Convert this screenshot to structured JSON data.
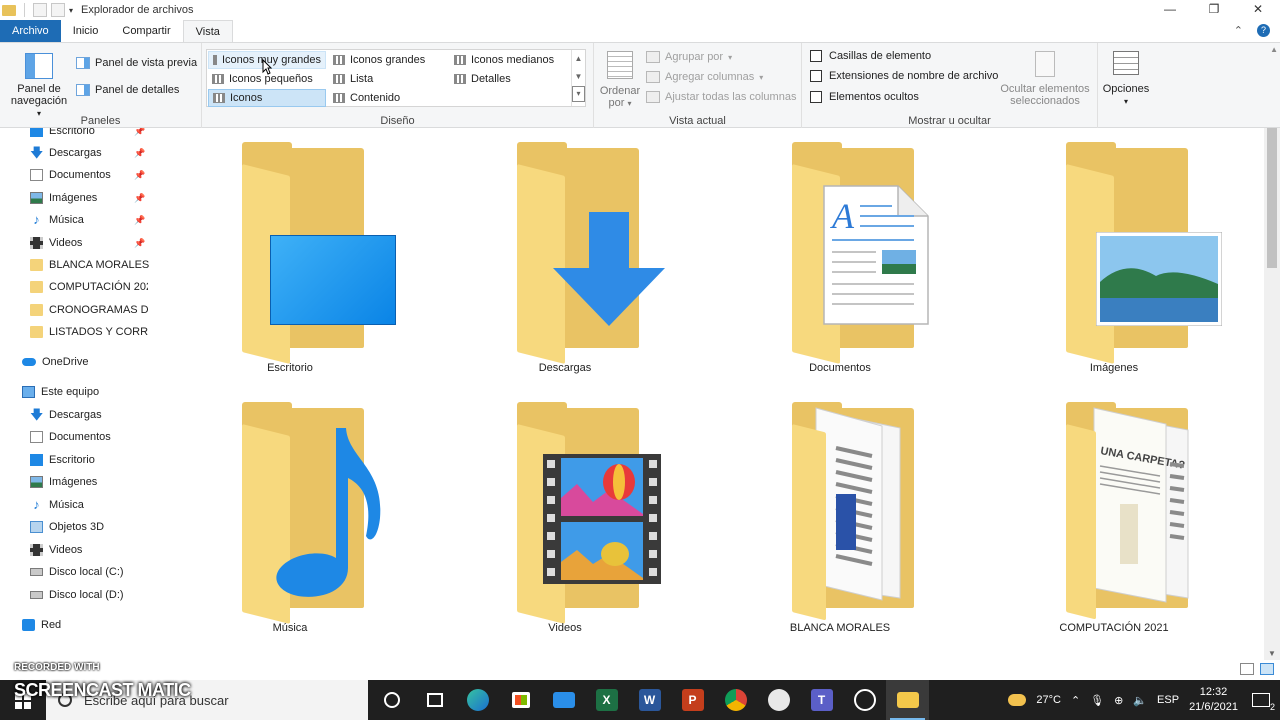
{
  "window": {
    "title": "Explorador de archivos",
    "min": "—",
    "max": "❐",
    "close": "✕"
  },
  "tabs": [
    "Archivo",
    "Inicio",
    "Compartir",
    "Vista"
  ],
  "ribbon": {
    "paneles": {
      "label": "Paneles",
      "nav_pane": "Panel de navegación",
      "preview": "Panel de vista previa",
      "details": "Panel de detalles"
    },
    "diseno": {
      "label": "Diseño",
      "layouts": [
        "Iconos muy grandes",
        "Iconos grandes",
        "Iconos medianos",
        "Iconos pequeños",
        "Lista",
        "Detalles",
        "Iconos",
        "Contenido"
      ],
      "selected": "Iconos",
      "hovered": "Iconos muy grandes"
    },
    "vista_actual": {
      "label": "Vista actual",
      "sort": "Ordenar por",
      "group": "Agrupar por",
      "add_cols": "Agregar columnas",
      "fit_cols": "Ajustar todas las columnas"
    },
    "mostrar": {
      "label": "Mostrar u ocultar",
      "checkboxes": [
        "Casillas de elemento",
        "Extensiones de nombre de archivo",
        "Elementos ocultos"
      ],
      "hide_selected": "Ocultar elementos seleccionados",
      "options": "Opciones"
    }
  },
  "nav": {
    "quick": [
      "Escritorio",
      "Descargas",
      "Documentos",
      "Imágenes",
      "Música",
      "Videos",
      "BLANCA MORALES",
      "COMPUTACIÓN 202",
      "CRONOGRAMAS DI",
      "LISTADOS Y CORREO"
    ],
    "onedrive": "OneDrive",
    "thispc": "Este equipo",
    "pc_items": [
      "Descargas",
      "Documentos",
      "Escritorio",
      "Imágenes",
      "Música",
      "Objetos 3D",
      "Videos",
      "Disco local (C:)",
      "Disco local (D:)"
    ],
    "network": "Red"
  },
  "items": [
    {
      "name": "Escritorio",
      "kind": "desktop"
    },
    {
      "name": "Descargas",
      "kind": "downloads"
    },
    {
      "name": "Documentos",
      "kind": "documents"
    },
    {
      "name": "Imágenes",
      "kind": "pictures"
    },
    {
      "name": "Música",
      "kind": "music"
    },
    {
      "name": "Videos",
      "kind": "videos"
    },
    {
      "name": "BLANCA MORALES",
      "kind": "docs-folder"
    },
    {
      "name": "COMPUTACIÓN 2021",
      "kind": "docs-folder"
    }
  ],
  "watermark": {
    "line1": "RECORDED WITH",
    "line2": "SCREENCAST  MATIC"
  },
  "taskbar": {
    "search_placeholder": "Escribe aquí para buscar",
    "weather": "27°C",
    "lang": "ESP",
    "time": "12:32",
    "date": "21/6/2021",
    "notif_count": "2"
  }
}
